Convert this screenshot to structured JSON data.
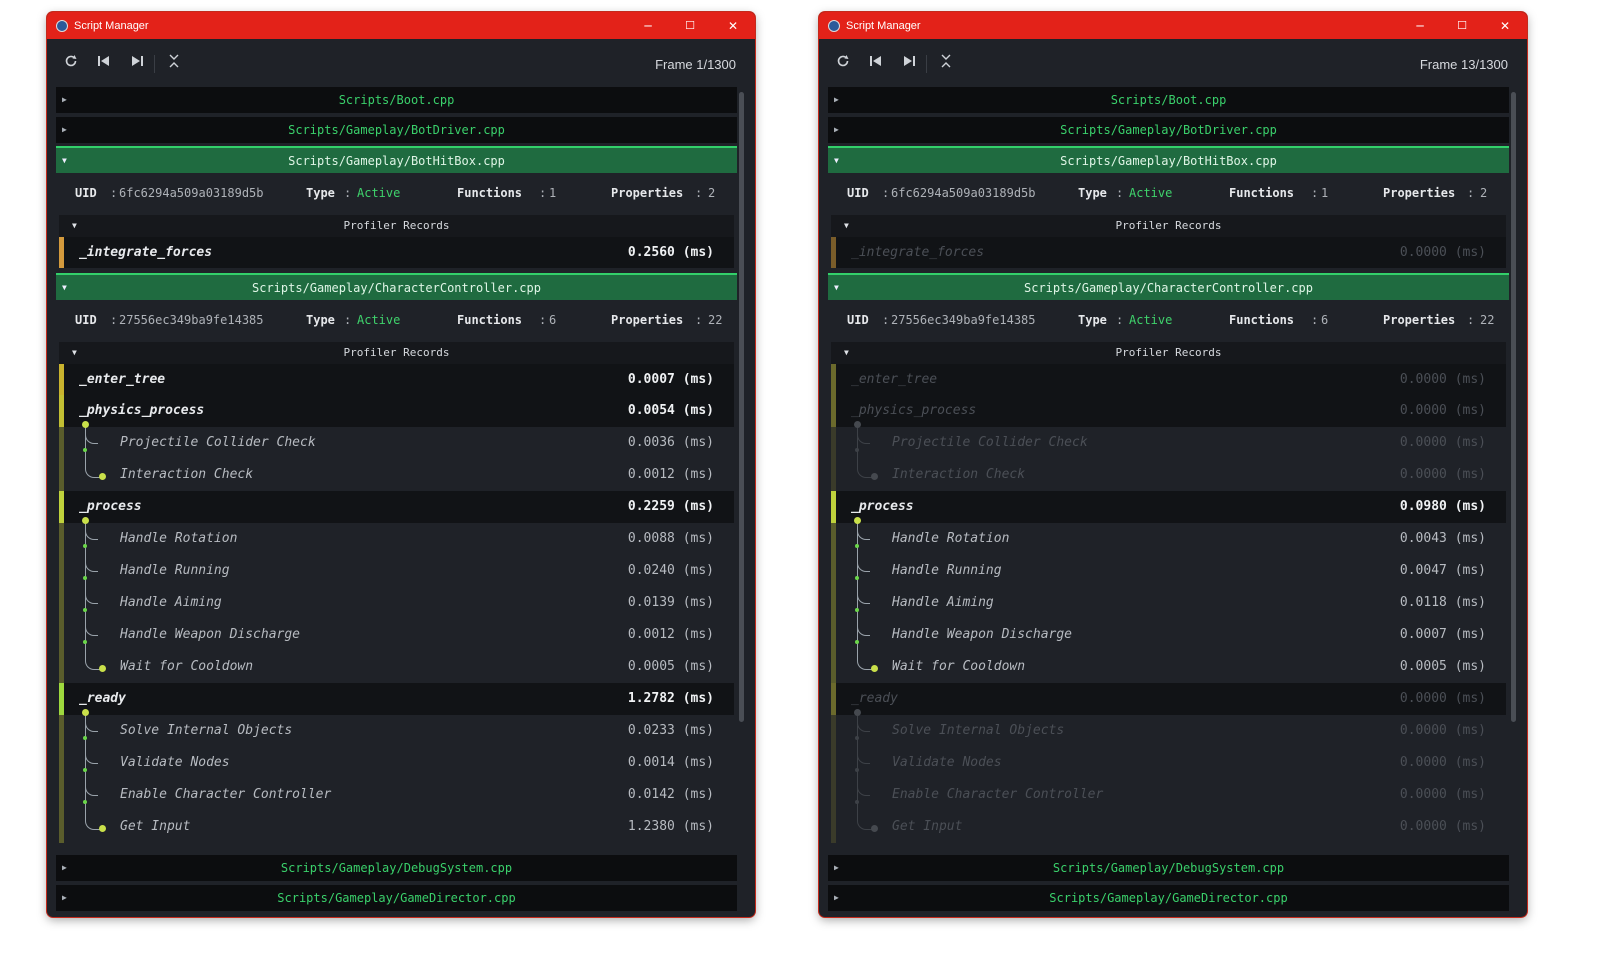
{
  "windows": [
    {
      "title": "Script Manager",
      "frame_label": "Frame 1/1300",
      "scripts_top": [
        "Scripts/Boot.cpp",
        "Scripts/Gameplay/BotDriver.cpp"
      ],
      "bothitbox": {
        "path": "Scripts/Gameplay/BotHitBox.cpp",
        "uid": "6fc6294a509a03189d5b",
        "type": "Active",
        "functions": "1",
        "properties": "2",
        "records_title": "Profiler Records",
        "records": [
          {
            "name": "_integrate_forces",
            "value": "0.2560 (ms)",
            "bar_color": "#d39a3d",
            "active": true
          }
        ]
      },
      "charcontroller": {
        "path": "Scripts/Gameplay/CharacterController.cpp",
        "uid": "27556ec349ba9fe14385",
        "type": "Active",
        "functions": "6",
        "properties": "22",
        "records_title": "Profiler Records",
        "records": [
          {
            "name": "_enter_tree",
            "value": "0.0007 (ms)",
            "bar_color": "#c9b32e",
            "active": true,
            "children": []
          },
          {
            "name": "_physics_process",
            "value": "0.0054 (ms)",
            "bar_color": "#c2bf33",
            "active": true,
            "children": [
              {
                "name": "Projectile Collider Check",
                "value": "0.0036 (ms)"
              },
              {
                "name": "Interaction Check",
                "value": "0.0012 (ms)"
              }
            ]
          },
          {
            "name": "_process",
            "value": "0.2259 (ms)",
            "bar_color": "#bfd23c",
            "active": true,
            "children": [
              {
                "name": "Handle Rotation",
                "value": "0.0088 (ms)"
              },
              {
                "name": "Handle Running",
                "value": "0.0240 (ms)"
              },
              {
                "name": "Handle Aiming",
                "value": "0.0139 (ms)"
              },
              {
                "name": "Handle Weapon Discharge",
                "value": "0.0012 (ms)"
              },
              {
                "name": "Wait for Cooldown",
                "value": "0.0005 (ms)"
              }
            ]
          },
          {
            "name": "_ready",
            "value": "1.2782 (ms)",
            "bar_color": "#9ed93e",
            "active": true,
            "children": [
              {
                "name": "Solve Internal Objects",
                "value": "0.0233 (ms)"
              },
              {
                "name": "Validate Nodes",
                "value": "0.0014 (ms)"
              },
              {
                "name": "Enable Character Controller",
                "value": "0.0142 (ms)"
              },
              {
                "name": "Get Input",
                "value": "1.2380 (ms)"
              }
            ]
          }
        ]
      },
      "scripts_bottom": [
        "Scripts/Gameplay/DebugSystem.cpp",
        "Scripts/Gameplay/GameDirector.cpp"
      ]
    },
    {
      "title": "Script Manager",
      "frame_label": "Frame 13/1300",
      "scripts_top": [
        "Scripts/Boot.cpp",
        "Scripts/Gameplay/BotDriver.cpp"
      ],
      "bothitbox": {
        "path": "Scripts/Gameplay/BotHitBox.cpp",
        "uid": "6fc6294a509a03189d5b",
        "type": "Active",
        "functions": "1",
        "properties": "2",
        "records_title": "Profiler Records",
        "records": [
          {
            "name": "_integrate_forces",
            "value": "0.0000 (ms)",
            "bar_color": "#d39a3d",
            "active": false
          }
        ]
      },
      "charcontroller": {
        "path": "Scripts/Gameplay/CharacterController.cpp",
        "uid": "27556ec349ba9fe14385",
        "type": "Active",
        "functions": "6",
        "properties": "22",
        "records_title": "Profiler Records",
        "records": [
          {
            "name": "_enter_tree",
            "value": "0.0000 (ms)",
            "bar_color": "#c9b32e",
            "active": false,
            "children": []
          },
          {
            "name": "_physics_process",
            "value": "0.0000 (ms)",
            "bar_color": "#c2bf33",
            "active": false,
            "children": [
              {
                "name": "Projectile Collider Check",
                "value": "0.0000 (ms)"
              },
              {
                "name": "Interaction Check",
                "value": "0.0000 (ms)"
              }
            ]
          },
          {
            "name": "_process",
            "value": "0.0980 (ms)",
            "bar_color": "#bfd23c",
            "active": true,
            "children": [
              {
                "name": "Handle Rotation",
                "value": "0.0043 (ms)"
              },
              {
                "name": "Handle Running",
                "value": "0.0047 (ms)"
              },
              {
                "name": "Handle Aiming",
                "value": "0.0118 (ms)"
              },
              {
                "name": "Handle Weapon Discharge",
                "value": "0.0007 (ms)"
              },
              {
                "name": "Wait for Cooldown",
                "value": "0.0005 (ms)"
              }
            ]
          },
          {
            "name": "_ready",
            "value": "0.0000 (ms)",
            "bar_color": "#9ed93e",
            "active": false,
            "children": [
              {
                "name": "Solve Internal Objects",
                "value": "0.0000 (ms)"
              },
              {
                "name": "Validate Nodes",
                "value": "0.0000 (ms)"
              },
              {
                "name": "Enable Character Controller",
                "value": "0.0000 (ms)"
              },
              {
                "name": "Get Input",
                "value": "0.0000 (ms)"
              }
            ]
          }
        ]
      },
      "scripts_bottom": [
        "Scripts/Gameplay/DebugSystem.cpp",
        "Scripts/Gameplay/GameDirector.cpp"
      ]
    }
  ],
  "labels": {
    "uid": "UID",
    "type": "Type",
    "functions": "Functions",
    "properties": "Properties",
    "sep": ":"
  },
  "icons": {
    "refresh": "refresh-icon",
    "step_back": "step-back-icon",
    "step_forward": "step-forward-icon",
    "collapse_all": "collapse-all-icon",
    "minimize": "minimize-icon",
    "maximize": "maximize-icon",
    "close": "close-icon"
  },
  "colors": {
    "titlebar": "#e32219",
    "accent_green": "#3fd36c",
    "open_header": "#1f6b40"
  }
}
